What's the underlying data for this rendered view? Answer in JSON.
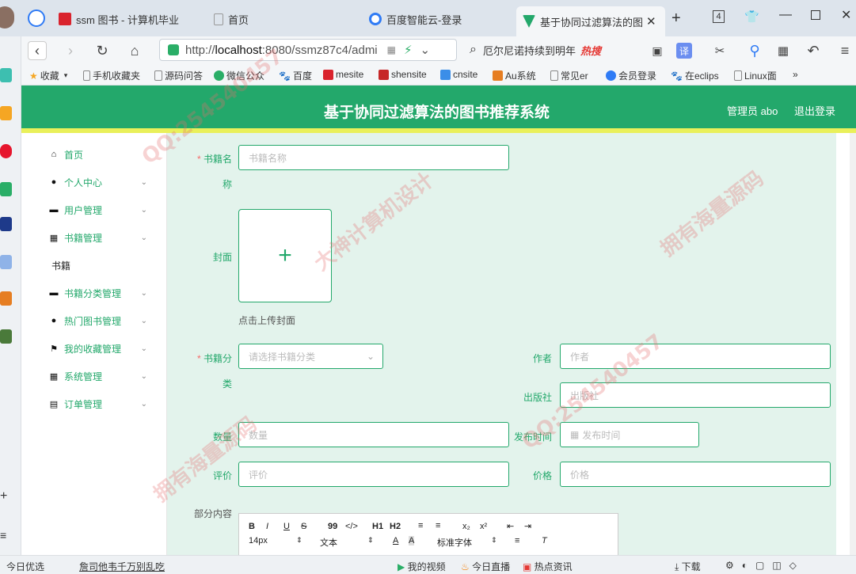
{
  "browser": {
    "tabs": [
      {
        "label": "ssm 图书 - 计算机毕业",
        "favicon_color": "#d9232d"
      },
      {
        "label": "首页",
        "favicon_color": "#ffffff"
      },
      {
        "label": "百度智能云-登录",
        "favicon_color": "#2f7bf5"
      },
      {
        "label": "基于协同过滤算法的图书",
        "favicon_color": "#23a86b",
        "active": true
      }
    ],
    "tab_counter": "4",
    "address_scheme": "http://",
    "address_host": "localhost",
    "address_rest": ":8080/ssmz87c4/admi",
    "search_text": "厄尔尼诺持续到明年",
    "search_hot": "热搜",
    "translate_label": "译"
  },
  "bookmarks": {
    "items": [
      {
        "label": "收藏",
        "color": "#f5a623"
      },
      {
        "label": "手机收藏夹",
        "color": "#888"
      },
      {
        "label": "源码问答",
        "color": "#888"
      },
      {
        "label": "微信公众",
        "color": "#2aae67"
      },
      {
        "label": "百度",
        "color": "#2f5fd6"
      },
      {
        "label": "mesite",
        "color": "#d9232d"
      },
      {
        "label": "shensite",
        "color": "#c62828"
      },
      {
        "label": "cnsite",
        "color": "#3b8ee8"
      },
      {
        "label": "Au系统",
        "color": "#e67e22"
      },
      {
        "label": "常见er",
        "color": "#888"
      },
      {
        "label": "会员登录",
        "color": "#2f7bf5"
      },
      {
        "label": "在eclips",
        "color": "#2f5fd6"
      },
      {
        "label": "Linux面",
        "color": "#888"
      }
    ],
    "more": "»"
  },
  "header": {
    "title": "基于协同过滤算法的图书推荐系统",
    "user": "管理员 abo",
    "logout": "退出登录"
  },
  "sidebar": {
    "items": [
      {
        "label": "首页",
        "icon": "home-icon",
        "glyph": "⌂",
        "has_children": false
      },
      {
        "label": "个人中心",
        "icon": "user-icon",
        "glyph": "●",
        "has_children": true
      },
      {
        "label": "用户管理",
        "icon": "monitor-icon",
        "glyph": "▬",
        "has_children": true
      },
      {
        "label": "书籍管理",
        "icon": "grid-icon",
        "glyph": "▦",
        "has_children": true
      },
      {
        "label": "书籍",
        "icon": "",
        "glyph": "",
        "has_children": false,
        "sub": true
      },
      {
        "label": "书籍分类管理",
        "icon": "monitor-icon",
        "glyph": "▬",
        "has_children": true
      },
      {
        "label": "热门图书管理",
        "icon": "bulb-icon",
        "glyph": "●",
        "has_children": true
      },
      {
        "label": "我的收藏管理",
        "icon": "flag-icon",
        "glyph": "⚑",
        "has_children": true
      },
      {
        "label": "系统管理",
        "icon": "grid-icon",
        "glyph": "▦",
        "has_children": true
      },
      {
        "label": "订单管理",
        "icon": "doc-icon",
        "glyph": "▤",
        "has_children": true
      }
    ]
  },
  "form": {
    "book_name_label_1": "书籍名",
    "book_name_label_2": "称",
    "book_name_placeholder": "书籍名称",
    "cover_label": "封面",
    "cover_upload_hint": "点击上传封面",
    "category_label_1": "书籍分",
    "category_label_2": "类",
    "category_placeholder": "请选择书籍分类",
    "author_label": "作者",
    "author_placeholder": "作者",
    "publisher_label": "出版社",
    "publisher_placeholder": "出版社",
    "quantity_label": "数量",
    "quantity_placeholder": "数量",
    "publish_time_label": "发布时间",
    "publish_time_placeholder": "发布时间",
    "rating_label": "评价",
    "rating_placeholder": "评价",
    "price_label": "价格",
    "price_placeholder": "价格",
    "partial_content_label": "部分内容"
  },
  "editor": {
    "toolbar_row1": [
      "B",
      "I",
      "U",
      "S",
      "99",
      "</>",
      "H1",
      "H2",
      "≡",
      "≡",
      "x₂",
      "x²",
      "⇤",
      "⇥"
    ],
    "font_size": "14px",
    "text_style": "文本",
    "font_family": "标准字体"
  },
  "statusbar": {
    "left_1": "今日优选",
    "left_2": "詹司他韦千万别乱吃",
    "video": "我的视频",
    "live": "今日直播",
    "news": "热点资讯",
    "download": "下载"
  },
  "watermarks": [
    "QQ:254540457",
    "大神计算机设计",
    "拥有海量源码"
  ],
  "colors": {
    "primary": "#23a86b",
    "accent_stripe": "#e9f05a",
    "main_bg": "#e3f3ec",
    "required": "#f56c6c"
  }
}
